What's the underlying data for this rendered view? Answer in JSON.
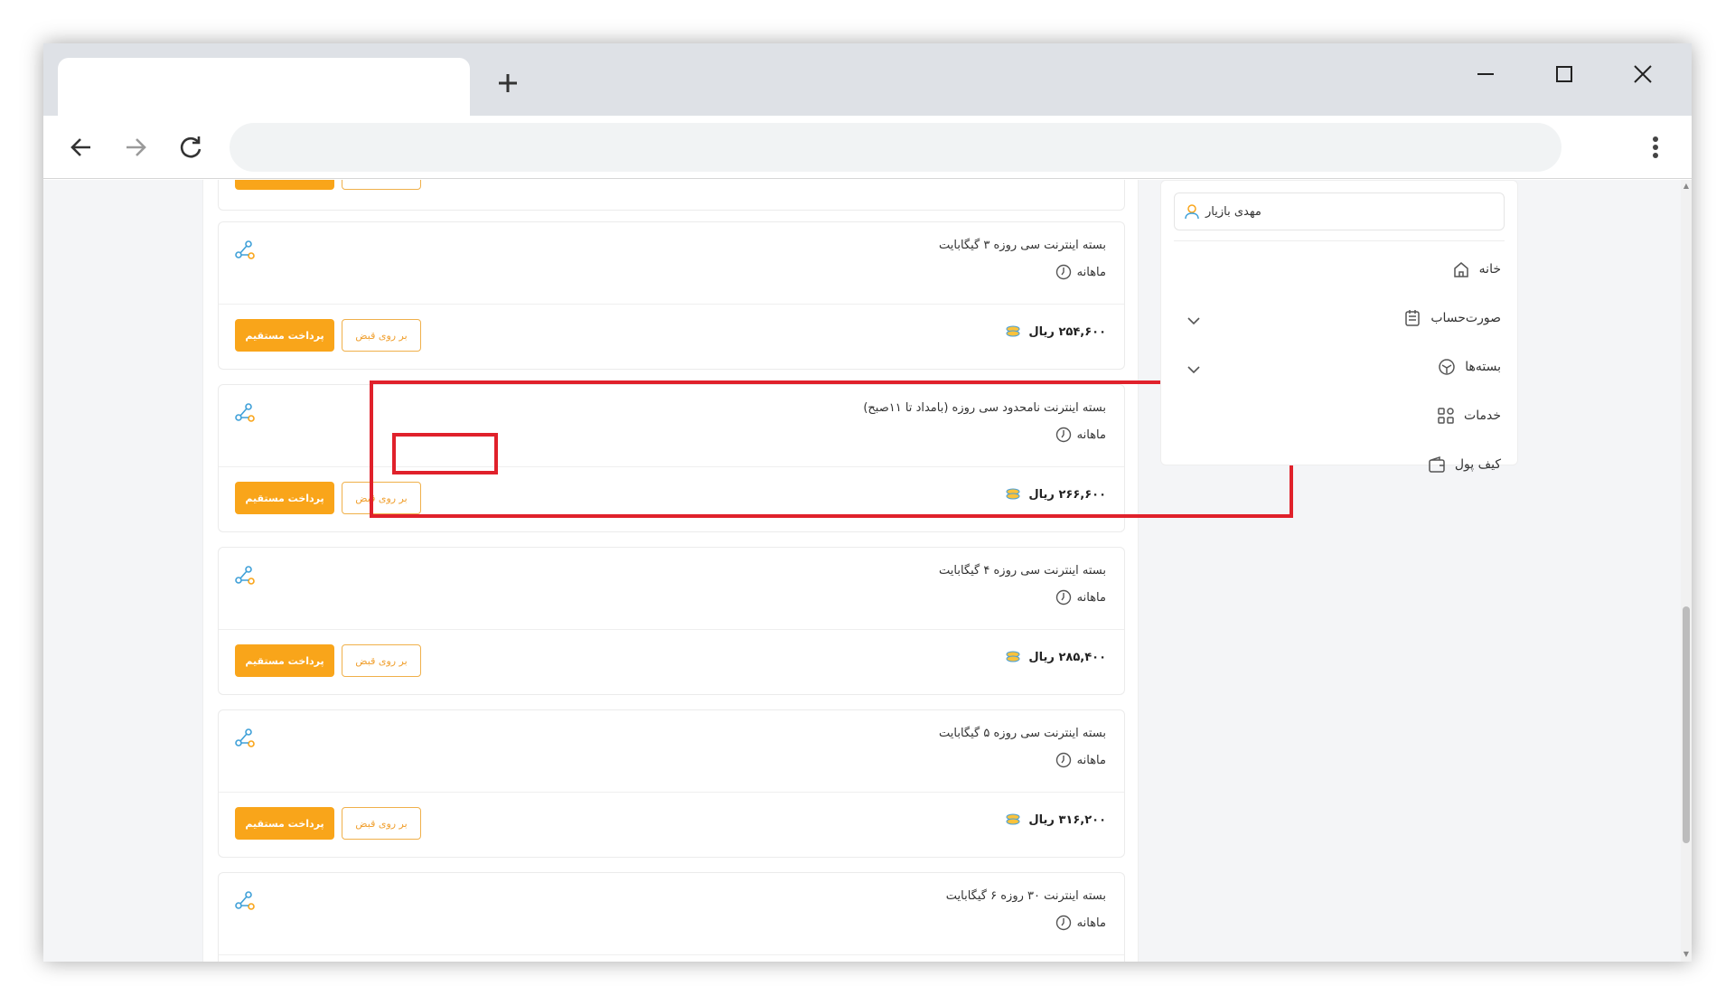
{
  "user": {
    "name": "مهدی بازیار"
  },
  "sidebar": {
    "items": [
      {
        "label": "خانه",
        "icon": "home-icon",
        "expandable": false
      },
      {
        "label": "صورت‌حساب",
        "icon": "invoice-icon",
        "expandable": true
      },
      {
        "label": "بسته‌ها",
        "icon": "package-icon",
        "expandable": true
      },
      {
        "label": "خدمات",
        "icon": "grid-icon",
        "expandable": false
      },
      {
        "label": "کیف پول",
        "icon": "wallet-icon",
        "expandable": false
      }
    ]
  },
  "buttons": {
    "pay": "پرداخت مستقیم",
    "bill": "بر روی قبض"
  },
  "packages": [
    {
      "title": "بسته اینترنت سی روزه ۳ گیگابایت",
      "period": "ماهانه",
      "price": "۲۵۴,۶۰۰ ریال"
    },
    {
      "title": "بسته اینترنت نامحدود سی روزه (بامداد تا ۱۱صبح)",
      "period": "ماهانه",
      "price": "۲۶۶,۶۰۰ ریال",
      "highlighted": true
    },
    {
      "title": "بسته اینترنت سی روزه ۴ گیگابایت",
      "period": "ماهانه",
      "price": "۲۸۵,۴۰۰ ریال"
    },
    {
      "title": "بسته اینترنت سی روزه ۵ گیگابایت",
      "period": "ماهانه",
      "price": "۳۱۶,۲۰۰ ریال"
    },
    {
      "title": "بسته اینترنت ۳۰ روزه ۶ گیگابایت",
      "period": "ماهانه",
      "price": ""
    }
  ],
  "colors": {
    "accent": "#f9a51a",
    "highlight": "#e0212b",
    "icon_blue": "#3fa0d8"
  }
}
